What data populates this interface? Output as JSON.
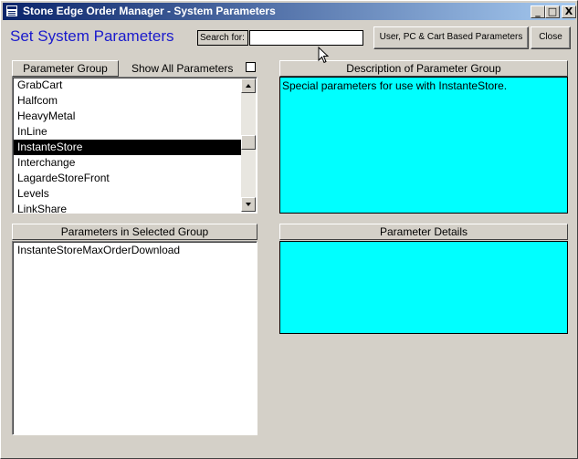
{
  "window": {
    "title": "Stone Edge Order Manager - System Parameters",
    "controls": {
      "minimize": "_",
      "maximize": "□",
      "close": "X"
    }
  },
  "form": {
    "heading": "Set System Parameters",
    "search_label": "Search for:",
    "search_value": "",
    "user_pc_cart_button": "User, PC & Cart Based Parameters",
    "close_button": "Close"
  },
  "parameter_group": {
    "header": "Parameter Group",
    "show_all_label": "Show All Parameters",
    "show_all_checked": false,
    "items": [
      "GrabCart",
      "Halfcom",
      "HeavyMetal",
      "InLine",
      "InstanteStore",
      "Interchange",
      "LagardeStoreFront",
      "Levels",
      "LinkShare"
    ],
    "selected": "InstanteStore"
  },
  "description": {
    "header": "Description of Parameter Group",
    "text": "Special parameters for use with InstanteStore."
  },
  "parameters": {
    "header": "Parameters in Selected Group",
    "items": [
      "InstanteStoreMaxOrderDownload"
    ]
  },
  "details": {
    "header": "Parameter Details",
    "text": ""
  },
  "colors": {
    "title_bar": "#0a246a",
    "heading": "#1a1acc",
    "panel_fill": "#00ffff",
    "selection": "#000000"
  }
}
